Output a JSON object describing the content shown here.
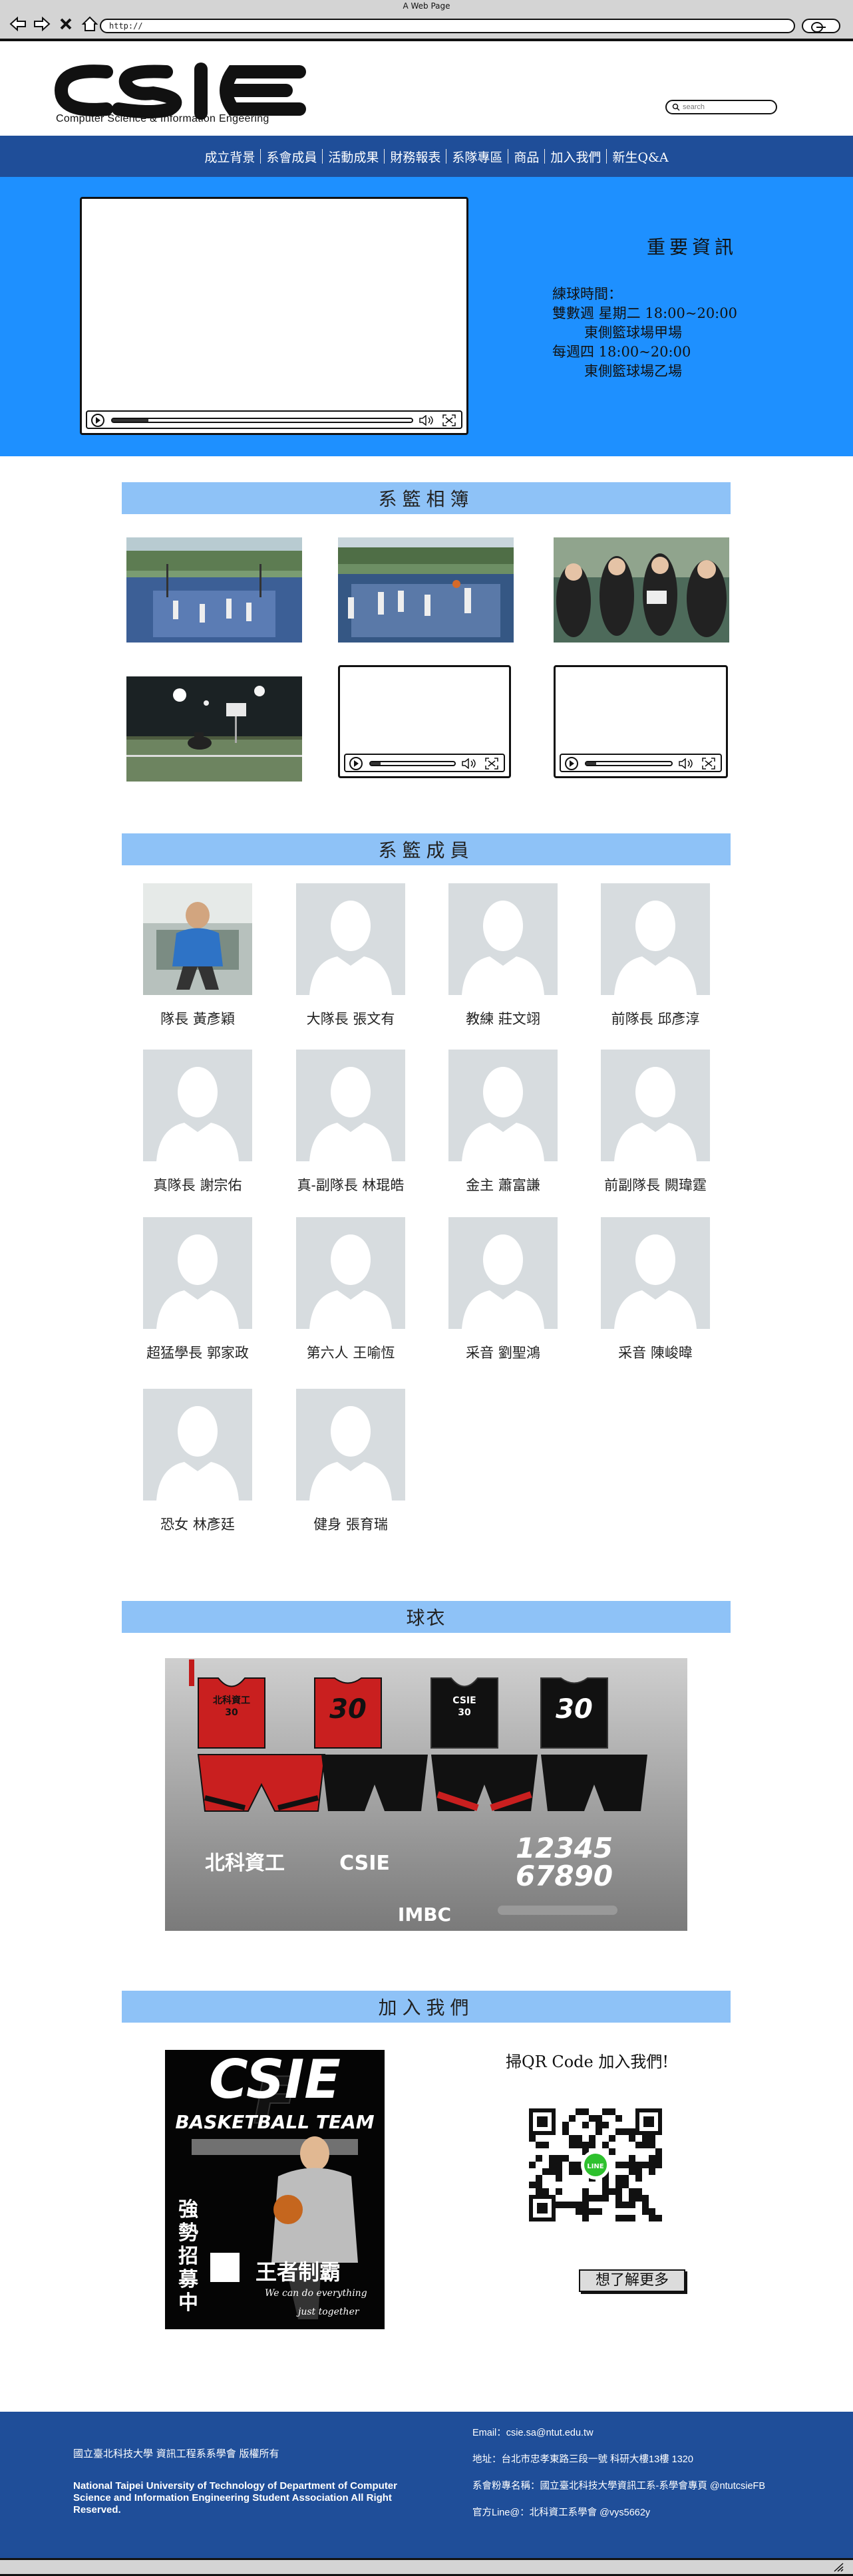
{
  "browser": {
    "title": "A Web Page",
    "url": "http://"
  },
  "header": {
    "logo_text": "CSIE",
    "logo_subtitle": "Computer Science & Information Engeering",
    "search_placeholder": "search"
  },
  "nav": {
    "items": [
      "成立背景",
      "系會成員",
      "活動成果",
      "財務報表",
      "系隊專區",
      "商品",
      "加入我們",
      "新生Q&A"
    ]
  },
  "info": {
    "title": "重要資訊",
    "lines": [
      "練球時間：",
      "雙數週 星期二 18:00~20:00",
      "東側籃球場甲場",
      "每週四 18:00~20:00",
      "東側籃球場乙場"
    ]
  },
  "sections": {
    "album": "系籃相簿",
    "members": "系籃成員",
    "jersey": "球衣",
    "join": "加入我們"
  },
  "members": [
    "隊長 黃彥穎",
    "大隊長 張文有",
    "教練 莊文翊",
    "前隊長 邱彥淳",
    "真隊長 謝宗佑",
    "真-副隊長 林琨皓",
    "金主 蕭富謙",
    "前副隊長 闕瑋霆",
    "超猛學長 郭家政",
    "第六人 王喻恆",
    "采音 劉聖鴻",
    "采音 陳峻暐",
    "恐女 林彥廷",
    "健身 張育瑞"
  ],
  "jersey": {
    "text_north": "北科資工",
    "text_number": "30",
    "text_csie": "CSIE",
    "text_digits_1": "12345",
    "text_digits_2": "67890",
    "brand": "IMBC"
  },
  "join": {
    "qr_text": "掃QR Code 加入我們!",
    "more_button": "想了解更多",
    "poster_title": "CSIE",
    "poster_subtitle": "BASKETBALL TEAM",
    "poster_recruit": "強勢招募中",
    "poster_slogan": "王者制霸",
    "poster_script_1": "We can do everything",
    "poster_script_2": "just together",
    "qr_badge": "LINE"
  },
  "footer": {
    "copyright": "國立臺北科技大學 資訊工程系系學會 版權所有",
    "english": "National Taipei University of Technology of Department of Computer Science and Information Engineering Student Association All Right Reserved.",
    "email": "Email：csie.sa@ntut.edu.tw",
    "address": "地址：台北市忠孝東路三段一號 科研大樓13樓 1320",
    "fanpage": "系會粉專名稱：國立臺北科技大學資訊工系-系學會專頁 @ntutcsieFB",
    "line": "官方Line@：北科資工系學會 @vys5662y"
  },
  "colors": {
    "nav": "#1f4e99",
    "hero": "#1e90ff",
    "section_head": "#8ec2f7",
    "footer": "#1f4e99"
  }
}
